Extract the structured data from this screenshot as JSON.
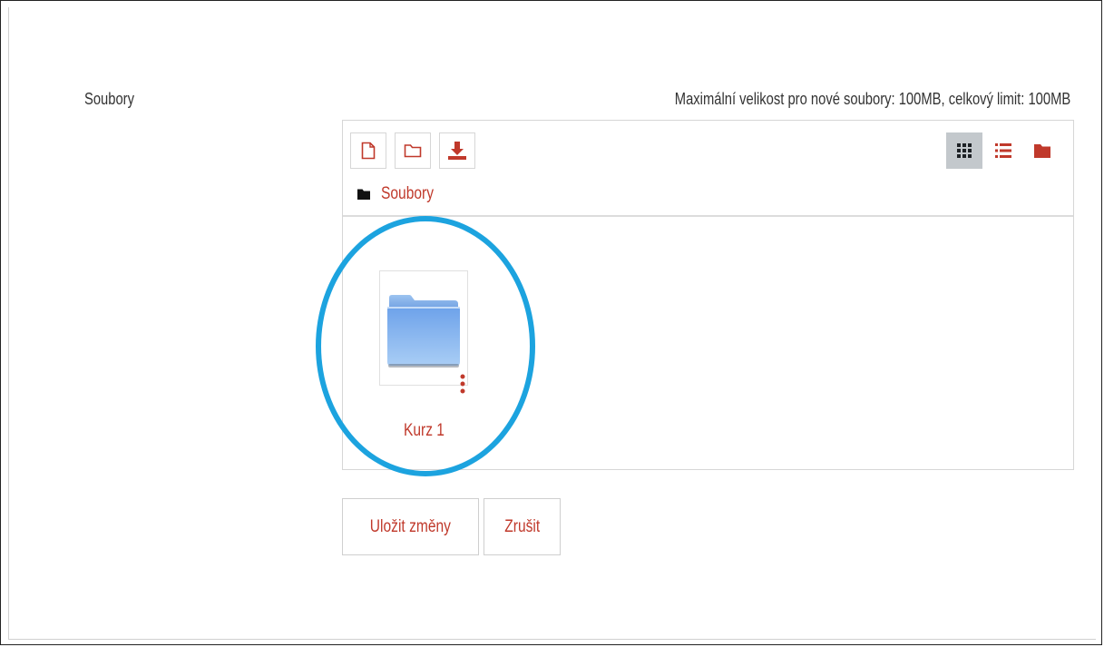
{
  "form": {
    "field_label": "Soubory",
    "limit_text": "Maximální velikost pro nové soubory: 100MB, celkový limit: 100MB"
  },
  "filemanager": {
    "toolbar": {
      "left_icons": [
        "add-file-icon",
        "create-folder-icon",
        "download-icon"
      ],
      "view_icons": [
        "grid-view-icon",
        "list-view-icon",
        "tree-view-icon"
      ],
      "active_view": "grid-view-icon"
    },
    "breadcrumb": {
      "label": "Soubory"
    },
    "items": [
      {
        "name": "Kurz 1",
        "type": "folder"
      }
    ]
  },
  "buttons": {
    "save": "Uložit změny",
    "cancel": "Zrušit"
  },
  "colors": {
    "accent": "#c0392b",
    "highlight_ring": "#1ca3df",
    "active_view_bg": "#c3c8cc"
  }
}
